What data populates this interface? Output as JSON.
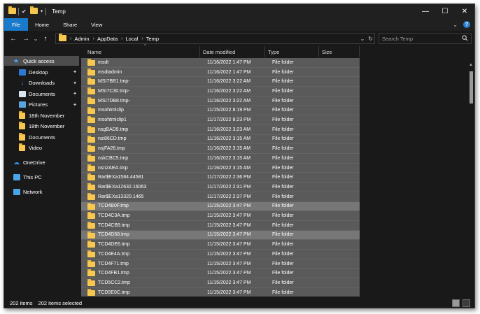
{
  "window": {
    "title": "Temp",
    "controls": {
      "minimize": "—",
      "maximize": "☐",
      "close": "✕"
    }
  },
  "ribbon": {
    "tabs": [
      {
        "label": "File"
      },
      {
        "label": "Home"
      },
      {
        "label": "Share"
      },
      {
        "label": "View"
      }
    ],
    "expand": "⌄",
    "help": "?"
  },
  "address": {
    "back": "←",
    "forward": "→",
    "recent": "⌄",
    "up": "↑",
    "crumbs": [
      "Admin",
      "AppData",
      "Local",
      "Temp"
    ],
    "separator": "›",
    "dropdown": "⌄",
    "refresh": "↻"
  },
  "search": {
    "placeholder": "Search Temp"
  },
  "nav": {
    "items": [
      {
        "label": "Quick access",
        "icon": "star-icon"
      },
      {
        "label": "Desktop",
        "icon": "desktop-icon",
        "pinned": true
      },
      {
        "label": "Downloads",
        "icon": "download-icon",
        "pinned": true
      },
      {
        "label": "Documents",
        "icon": "documents-icon",
        "pinned": true
      },
      {
        "label": "Pictures",
        "icon": "pictures-icon",
        "pinned": true
      },
      {
        "label": "18th November",
        "icon": "folder-icon"
      },
      {
        "label": "18th November",
        "icon": "folder-icon"
      },
      {
        "label": "Documents",
        "icon": "folder-icon"
      },
      {
        "label": "Video",
        "icon": "folder-icon"
      },
      {
        "label": "OneDrive",
        "icon": "cloud-icon"
      },
      {
        "label": "This PC",
        "icon": "pc-icon"
      },
      {
        "label": "Network",
        "icon": "network-icon"
      }
    ],
    "pin_glyph": "📌"
  },
  "list": {
    "columns": {
      "name": "Name",
      "date": "Date modified",
      "type": "Type",
      "size": "Size"
    },
    "sort_glyph": "^",
    "rows": [
      {
        "name": "msdt",
        "date": "11/16/2022 1:47 PM",
        "type": "File folder"
      },
      {
        "name": "msdtadmin",
        "date": "11/16/2022 1:47 PM",
        "type": "File folder"
      },
      {
        "name": "MSI7BB1.tmp-",
        "date": "11/16/2022 3:22 AM",
        "type": "File folder"
      },
      {
        "name": "MSI7C30.tmp-",
        "date": "11/16/2022 3:22 AM",
        "type": "File folder"
      },
      {
        "name": "MSI7DB8.tmp-",
        "date": "11/16/2022 3:22 AM",
        "type": "File folder"
      },
      {
        "name": "msohtmlclip",
        "date": "11/15/2022 8:19 PM",
        "type": "File folder"
      },
      {
        "name": "msohtmlclip1",
        "date": "11/17/2022 8:23 PM",
        "type": "File folder"
      },
      {
        "name": "nsgBAD9.tmp",
        "date": "11/16/2022 3:23 AM",
        "type": "File folder"
      },
      {
        "name": "nsi86CD.tmp",
        "date": "11/16/2022 3:15 AM",
        "type": "File folder"
      },
      {
        "name": "nsjFA26.tmp",
        "date": "11/16/2022 3:15 AM",
        "type": "File folder"
      },
      {
        "name": "nskCBC5.tmp",
        "date": "11/16/2022 3:15 AM",
        "type": "File folder"
      },
      {
        "name": "nsn2AEA.tmp",
        "date": "11/16/2022 3:15 AM",
        "type": "File folder"
      },
      {
        "name": "Rar$EXa1584.44581",
        "date": "11/17/2022 2:36 PM",
        "type": "File folder"
      },
      {
        "name": "Rar$EXa12632.16063",
        "date": "11/17/2022 2:31 PM",
        "type": "File folder"
      },
      {
        "name": "Rar$EXa13320.1465",
        "date": "11/17/2022 2:37 PM",
        "type": "File folder"
      },
      {
        "name": "TCD4B0F.tmp",
        "date": "11/15/2022 3:47 PM",
        "type": "File folder",
        "highlight": true
      },
      {
        "name": "TCD4C3A.tmp",
        "date": "11/15/2022 3:47 PM",
        "type": "File folder"
      },
      {
        "name": "TCD4CB9.tmp",
        "date": "11/15/2022 3:47 PM",
        "type": "File folder"
      },
      {
        "name": "TCD4D58.tmp",
        "date": "11/15/2022 3:47 PM",
        "type": "File folder",
        "highlight": true
      },
      {
        "name": "TCD4DE6.tmp",
        "date": "11/15/2022 3:47 PM",
        "type": "File folder"
      },
      {
        "name": "TCD4E4A.tmp",
        "date": "11/15/2022 3:47 PM",
        "type": "File folder"
      },
      {
        "name": "TCD4F71.tmp",
        "date": "11/15/2022 3:47 PM",
        "type": "File folder"
      },
      {
        "name": "TCD4FB1.tmp",
        "date": "11/15/2022 3:47 PM",
        "type": "File folder"
      },
      {
        "name": "TCD5CC2.tmp",
        "date": "11/15/2022 3:47 PM",
        "type": "File folder"
      },
      {
        "name": "TCD5E0C.tmp",
        "date": "11/15/2022 3:47 PM",
        "type": "File folder"
      }
    ]
  },
  "status": {
    "items_count": "202 items",
    "selected": "202 items selected"
  },
  "colors": {
    "file_tab": "#1979ca",
    "folder": "#f7c84d",
    "selection": "#5a5a5a",
    "highlight": "#777777",
    "background": "#191919"
  }
}
